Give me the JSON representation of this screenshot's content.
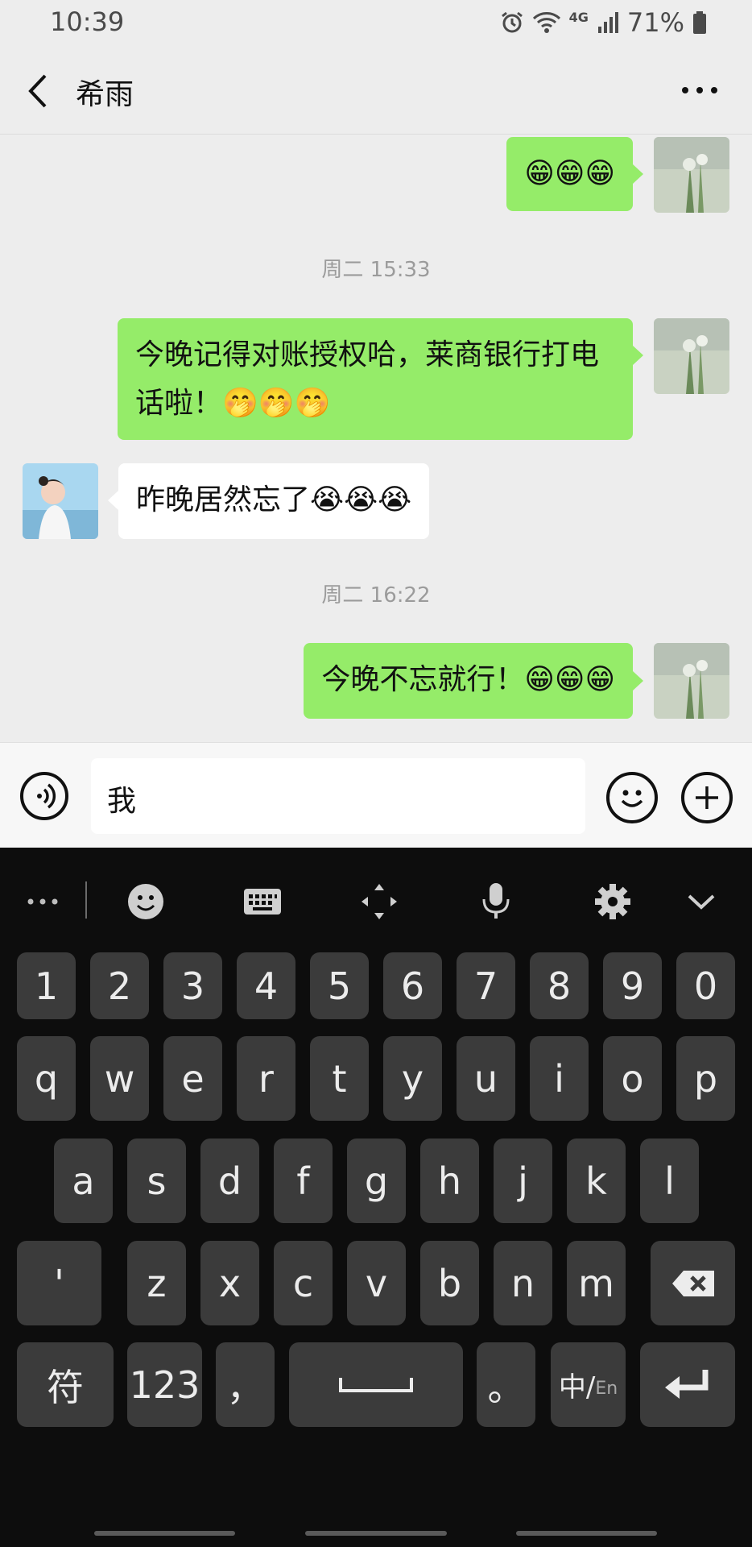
{
  "status_bar": {
    "time": "10:39",
    "network": "4G",
    "battery": "71%"
  },
  "header": {
    "title": "希雨"
  },
  "messages": {
    "m1": "😁😁😁",
    "t1": "周二 15:33",
    "m2": "今晚记得对账授权哈，莱商银行打电话啦！🤭🤭🤭",
    "m3": "昨晚居然忘了😭😭😭",
    "t2": "周二 16:22",
    "m4": "今晚不忘就行！😁😁😁"
  },
  "input": {
    "value": "我"
  },
  "keyboard": {
    "numbers": [
      "1",
      "2",
      "3",
      "4",
      "5",
      "6",
      "7",
      "8",
      "9",
      "0"
    ],
    "row1": [
      "q",
      "w",
      "e",
      "r",
      "t",
      "y",
      "u",
      "i",
      "o",
      "p"
    ],
    "row2": [
      "a",
      "s",
      "d",
      "f",
      "g",
      "h",
      "j",
      "k",
      "l"
    ],
    "row3_left": "'",
    "row3": [
      "z",
      "x",
      "c",
      "v",
      "b",
      "n",
      "m"
    ],
    "symbols": "符",
    "num_mode": "123",
    "comma": "，",
    "period": "。",
    "lang_main": "中/",
    "lang_sub": "En"
  },
  "colors": {
    "sent_bubble": "#95ec69",
    "received_bubble": "#ffffff",
    "chat_bg": "#ededed",
    "keyboard_bg": "#0d0d0d"
  }
}
